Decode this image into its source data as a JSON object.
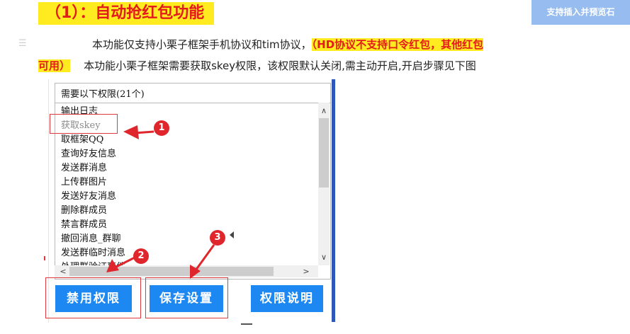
{
  "heading": "（1）：自动抢红包功能",
  "embed_button": "支持插入并预览石",
  "paragraph": {
    "line1_prefix": "本功能仅支持小栗子框架手机协议和tim协议，",
    "line1_highlight": "（HD协议不支持口令红包，其他红包",
    "line2_highlight": "可用）",
    "line2_text": "本功能小栗子框架需要获取skey权限，该权限默认关闭,需主动开启,开启步骤见下图"
  },
  "permission_dialog": {
    "list_header": "需要以下权限(21个)",
    "items": [
      "输出日志",
      "获取skey",
      "取框架QQ",
      "查询好友信息",
      "发送群消息",
      "上传群图片",
      "发送好友消息",
      "删除群成员",
      "禁言群成员",
      "撤回消息_群聊",
      "发送群临时消息",
      "处理群验证事件"
    ],
    "selected_index": 1,
    "scroll_up": "∧",
    "scroll_down": "∨",
    "scroll_left": "<",
    "scroll_right": ">",
    "buttons": {
      "disable": "禁用权限",
      "save": "保存设置",
      "explain": "权限说明"
    }
  },
  "annotations": {
    "step1": "1",
    "step2": "2",
    "step3": "3"
  },
  "colors": {
    "highlight_bg": "#ffeb1f",
    "highlight_text": "#e31b1b",
    "button_blue": "#1e88f2",
    "annotation_red": "#e0262d",
    "dialog_edge": "#2e57b9"
  }
}
